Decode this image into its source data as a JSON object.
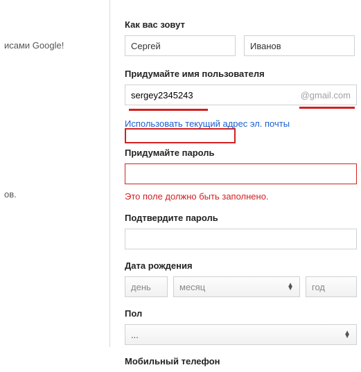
{
  "left": {
    "text1": "исами Google!",
    "text2": "ов."
  },
  "form": {
    "name_label": "Как вас зовут",
    "first_name": "Сергей",
    "last_name": "Иванов",
    "username_label": "Придумайте имя пользователя",
    "username_value": "sergey2345243",
    "username_domain": "@gmail.com",
    "use_current_link": "Использовать текущий адрес эл. почты",
    "password_label": "Придумайте пароль",
    "password_error": "Это поле должно быть заполнено.",
    "confirm_label": "Подтвердите пароль",
    "dob_label": "Дата рождения",
    "dob_day_ph": "день",
    "dob_month_ph": "месяц",
    "dob_year_ph": "год",
    "gender_label": "Пол",
    "gender_value": "...",
    "phone_label": "Мобильный телефон"
  }
}
